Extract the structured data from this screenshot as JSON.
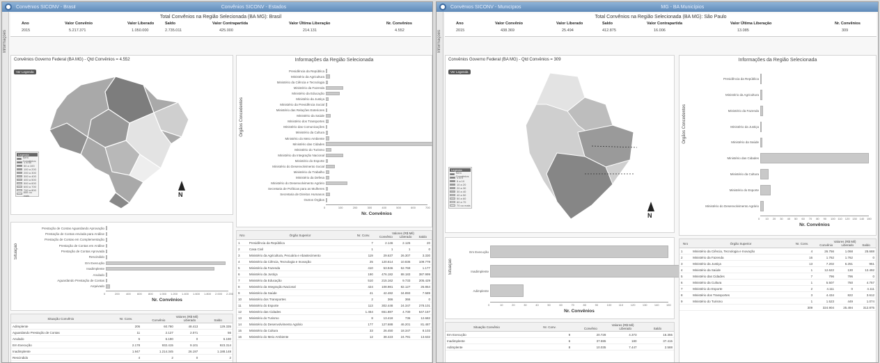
{
  "left": {
    "window_title": "Convênios SICONV - Brasil",
    "window_title2": "Convênios SICONV - Estados",
    "side_tab": "Informações",
    "summary": {
      "title": "Total Convênios na Região Selecionada (BA MG): Brasil",
      "headers": [
        "Ano",
        "Valor Convênio",
        "Valor Liberado",
        "Saldo",
        "Valor Contrapartida",
        "Valor Última Liberação",
        "Nr. Convênios"
      ],
      "values": [
        "2015",
        "5.217.371",
        "1.050.000",
        "2.735.011",
        "425.000",
        "214.131",
        "4.552"
      ]
    },
    "map_panel": {
      "title": "Convênios Governo Federal (BA MG) - Qtd Convênios = 4.552",
      "button": "Ver Legenda",
      "legend_title": "Legenda",
      "legend_items": [
        "Sem Convênios",
        "1 a 50",
        "50 a 100",
        "100 a 200",
        "200 a 300",
        "300 a 400",
        "400 a 500",
        "500 a 600",
        "600 a 700",
        "700 a 800",
        "800 ou mais"
      ],
      "north": "N"
    },
    "orgao_chart": {
      "title": "Informações da Região Selecionada",
      "ylabel": "Órgãos Concedentes",
      "xlabel": "Nr. Convênios",
      "ticks": [
        "0",
        "100",
        "200",
        "300",
        "400",
        "500",
        "600",
        "700"
      ],
      "rows": [
        {
          "label": "Presidência da República",
          "value": 5
        },
        {
          "label": "Ministério da Agricultura",
          "value": 30
        },
        {
          "label": "Ministério da Ciência e Tecnologia",
          "value": 12
        },
        {
          "label": "Ministério da Fazenda",
          "value": 120
        },
        {
          "label": "Ministério da Educação",
          "value": 95
        },
        {
          "label": "Ministério da Justiça",
          "value": 20
        },
        {
          "label": "Ministério da Previdência Social",
          "value": 8
        },
        {
          "label": "Ministério das Relações Exteriores",
          "value": 5
        },
        {
          "label": "Ministério da Saúde",
          "value": 35
        },
        {
          "label": "Ministério dos Transportes",
          "value": 18
        },
        {
          "label": "Ministério das Comunicações",
          "value": 10
        },
        {
          "label": "Ministério da Cultura",
          "value": 14
        },
        {
          "label": "Ministério do Meio Ambiente",
          "value": 25
        },
        {
          "label": "Ministério das Cidades",
          "value": 780
        },
        {
          "label": "Ministério do Turismo",
          "value": 40
        },
        {
          "label": "Ministério da Integração Nacional",
          "value": 120
        },
        {
          "label": "Ministério do Esporte",
          "value": 15
        },
        {
          "label": "Ministério do Desenvolvimento Social",
          "value": 60
        },
        {
          "label": "Ministério do Trabalho",
          "value": 22
        },
        {
          "label": "Ministério da Defesa",
          "value": 26
        },
        {
          "label": "Ministério do Desenvolvimento Agrário",
          "value": 150
        },
        {
          "label": "Secretaria de Políticas para as Mulheres",
          "value": 12
        },
        {
          "label": "Secretaria de Direitos Humanos",
          "value": 28
        },
        {
          "label": "Outros Órgãos",
          "value": 4
        }
      ]
    },
    "situacao_chart": {
      "ylabel": "Situação",
      "xlabel": "Nr. Convênios",
      "ticks": [
        "0",
        "200",
        "400",
        "600",
        "800",
        "1.000",
        "1.200",
        "1.400",
        "1.600",
        "1.800",
        "2.000",
        "2.200"
      ],
      "rows": [
        {
          "label": "Prestação de Contas Aguardando Aprovação",
          "value": 10
        },
        {
          "label": "Prestação de Contas enviada para Análise",
          "value": 12
        },
        {
          "label": "Prestação de Contas em Complementação",
          "value": 8
        },
        {
          "label": "Prestação de Contas em Análise",
          "value": 10
        },
        {
          "label": "Prestação de Contas Aprovada",
          "value": 15
        },
        {
          "label": "Rescindido",
          "value": 5
        },
        {
          "label": "Em Execução",
          "value": 2150
        },
        {
          "label": "Inadimplente",
          "value": 1950
        },
        {
          "label": "Anulado",
          "value": 5
        },
        {
          "label": "Aguardando Prestação de Contas",
          "value": 20
        },
        {
          "label": "Arquivado",
          "value": 80
        }
      ]
    },
    "situacao_table": {
      "headers": [
        "Situação Convênio",
        "Nr. Conv.",
        "Convênio",
        "Liberado",
        "Saldo"
      ],
      "group_header": "Valores (R$ Mil)",
      "rows": [
        [
          "Adimplente",
          "205",
          "60.780",
          "48.413",
          "129.335"
        ],
        [
          "Aguardando Prestação de Contas",
          "11",
          "2.127",
          "2.071",
          "56"
        ],
        [
          "Anulado",
          "5",
          "6.190",
          "0",
          "6.190"
        ],
        [
          "Em Execução",
          "2.178",
          "932.415",
          "9.101",
          "923.314"
        ],
        [
          "Inadimplente",
          "1.947",
          "1.214.345",
          "26.197",
          "1.188.148"
        ],
        [
          "Rescindido",
          "4",
          "2",
          "0",
          "2"
        ]
      ]
    },
    "orgao_table": {
      "headers": [
        "Nro",
        "Órgão Superior",
        "Nr. Conv.",
        "Convênio",
        "Liberado",
        "Saldo"
      ],
      "group_header": "Valores (R$ Mil)",
      "rows": [
        [
          "1",
          "Presidência da República",
          "7",
          "2.146",
          "2.126",
          "20"
        ],
        [
          "2",
          "Casa Civil",
          "1",
          "1",
          "1",
          "0"
        ],
        [
          "3",
          "Ministério da Agricultura, Pecuária e Abastecimento",
          "119",
          "29.637",
          "26.307",
          "3.330"
        ],
        [
          "4",
          "Ministério da Ciência, Tecnologia e Inovação",
          "25",
          "120.614",
          "10.836",
          "109.778"
        ],
        [
          "5",
          "Ministério da Fazenda",
          "410",
          "53.946",
          "52.769",
          "1.177"
        ],
        [
          "6",
          "Ministério da Justiça",
          "190",
          "476.182",
          "88.183",
          "387.999"
        ],
        [
          "7",
          "Ministério da Educação",
          "510",
          "215.162",
          "9.733",
          "205.429"
        ],
        [
          "8",
          "Ministério da Integração Nacional",
          "424",
          "108.981",
          "82.127",
          "26.854"
        ],
        [
          "9",
          "Ministério da Saúde",
          "41",
          "42.482",
          "34.893",
          "7.589"
        ],
        [
          "10",
          "Ministério dos Transportes",
          "2",
          "366",
          "366",
          "0"
        ],
        [
          "11",
          "Ministério do Esporte",
          "113",
          "302.448",
          "24.347",
          "278.101"
        ],
        [
          "12",
          "Ministério das Cidades",
          "1.454",
          "651.887",
          "4.730",
          "647.157"
        ],
        [
          "13",
          "Ministério do Turismo",
          "8",
          "13.418",
          "736",
          "12.682"
        ],
        [
          "14",
          "Ministério do Desenvolvimento Agrário",
          "177",
          "127.688",
          "46.201",
          "81.487"
        ],
        [
          "15",
          "Ministério da Cultura",
          "33",
          "26.450",
          "18.347",
          "8.103"
        ],
        [
          "16",
          "Ministério do Meio Ambiente",
          "12",
          "38.423",
          "24.791",
          "13.632"
        ]
      ]
    }
  },
  "right": {
    "window_title": "Convênios SICONV - Municípios",
    "window_title2": "MG - BA Municípios",
    "side_tab": "Informações",
    "summary": {
      "title": "Total Convênios na Região Selecionada (BA MG): São Paulo",
      "headers": [
        "Ano",
        "Valor Convênio",
        "Valor Liberado",
        "Saldo",
        "Valor Contrapartida",
        "Valor Última Liberação",
        "Nr. Convênios"
      ],
      "values": [
        "2015",
        "438.369",
        "25.494",
        "412.875",
        "16.006",
        "13.085",
        "309"
      ]
    },
    "map_panel": {
      "title": "Convênios Governo Federal (BA MG) - Qtd Convênios = 309",
      "button": "Ver Legenda",
      "legend_title": "Legenda",
      "legend_items": [
        "Sem Convênios",
        "1 a 5",
        "5 a 10",
        "10 a 20",
        "20 a 30",
        "30 a 40",
        "40 a 50",
        "50 a 60",
        "60 a 70",
        "70 ou mais"
      ],
      "north": "N"
    },
    "orgao_chart": {
      "title": "Informações da Região Selecionada",
      "ylabel": "Órgãos Concedentes",
      "xlabel": "Nr. Convênios",
      "ticks": [
        "0",
        "10",
        "20",
        "30",
        "40",
        "50",
        "60",
        "70",
        "80",
        "90",
        "100",
        "110",
        "120",
        "130",
        "140",
        "150"
      ],
      "rows": [
        {
          "label": "Presidência da República",
          "value": 2
        },
        {
          "label": "Ministério da Agricultura",
          "value": 3
        },
        {
          "label": "Ministério da Fazenda",
          "value": 4
        },
        {
          "label": "Ministério da Justiça",
          "value": 2
        },
        {
          "label": "Ministério da Saúde",
          "value": 3
        },
        {
          "label": "Ministério das Cidades",
          "value": 150
        },
        {
          "label": "Ministério da Cultura",
          "value": 12
        },
        {
          "label": "Ministério do Esporte",
          "value": 14
        },
        {
          "label": "Ministério do Desenvolvimento Agrário",
          "value": 5
        }
      ]
    },
    "situacao_chart": {
      "ylabel": "Situação",
      "xlabel": "Nr. Convênios",
      "ticks": [
        "0",
        "10",
        "20",
        "30",
        "40",
        "50",
        "60",
        "70",
        "80",
        "90",
        "100",
        "110",
        "120",
        "130",
        "140",
        "150"
      ],
      "rows": [
        {
          "label": "Em Execução",
          "value": 150
        },
        {
          "label": "Inadimplente",
          "value": 170
        },
        {
          "label": "Adimplente",
          "value": 28
        }
      ]
    },
    "situacao_table": {
      "headers": [
        "Situação Convênio",
        "Nr. Conv.",
        "Convênio",
        "Liberado",
        "Saldo"
      ],
      "group_header": "Valores (R$ Mil)",
      "rows": [
        [
          "Em Execução",
          "9",
          "20.728",
          "4.373",
          "16.355"
        ],
        [
          "Inadimplente",
          "6",
          "37.595",
          "180",
          "37.415"
        ],
        [
          "Adimplente",
          "8",
          "10.035",
          "7.447",
          "2.588"
        ]
      ]
    },
    "orgao_table": {
      "headers": [
        "Nro",
        "Órgão Superior",
        "Nr. Conv.",
        "Convênio",
        "Liberado",
        "Saldo"
      ],
      "group_header": "Valores (R$ Mil)",
      "rows": [
        [
          "1",
          "Ministério da Ciência, Tecnologia e Inovação",
          "4",
          "26.756",
          "1.068",
          "25.688"
        ],
        [
          "2",
          "Ministério da Fazenda",
          "16",
          "1.762",
          "1.762",
          "0"
        ],
        [
          "3",
          "Ministério da Justiça",
          "13",
          "7.202",
          "6.251",
          "951"
        ],
        [
          "4",
          "Ministério da Saúde",
          "1",
          "12.622",
          "130",
          "12.492"
        ],
        [
          "5",
          "Ministério das Cidades",
          "7",
          "796",
          "796",
          "0"
        ],
        [
          "6",
          "Ministério da Cultura",
          "1",
          "5.507",
          "750",
          "4.757"
        ],
        [
          "7",
          "Ministério do Esporte",
          "2",
          "4.111",
          "0",
          "4.111"
        ],
        [
          "8",
          "Ministério dos Transportes",
          "3",
          "4.434",
          "822",
          "3.612"
        ],
        [
          "9",
          "Ministério do Turismo",
          "1",
          "1.523",
          "449",
          "1.074"
        ]
      ],
      "total": [
        "",
        "",
        "309",
        "324.904",
        "25.494",
        "312.875"
      ]
    }
  }
}
